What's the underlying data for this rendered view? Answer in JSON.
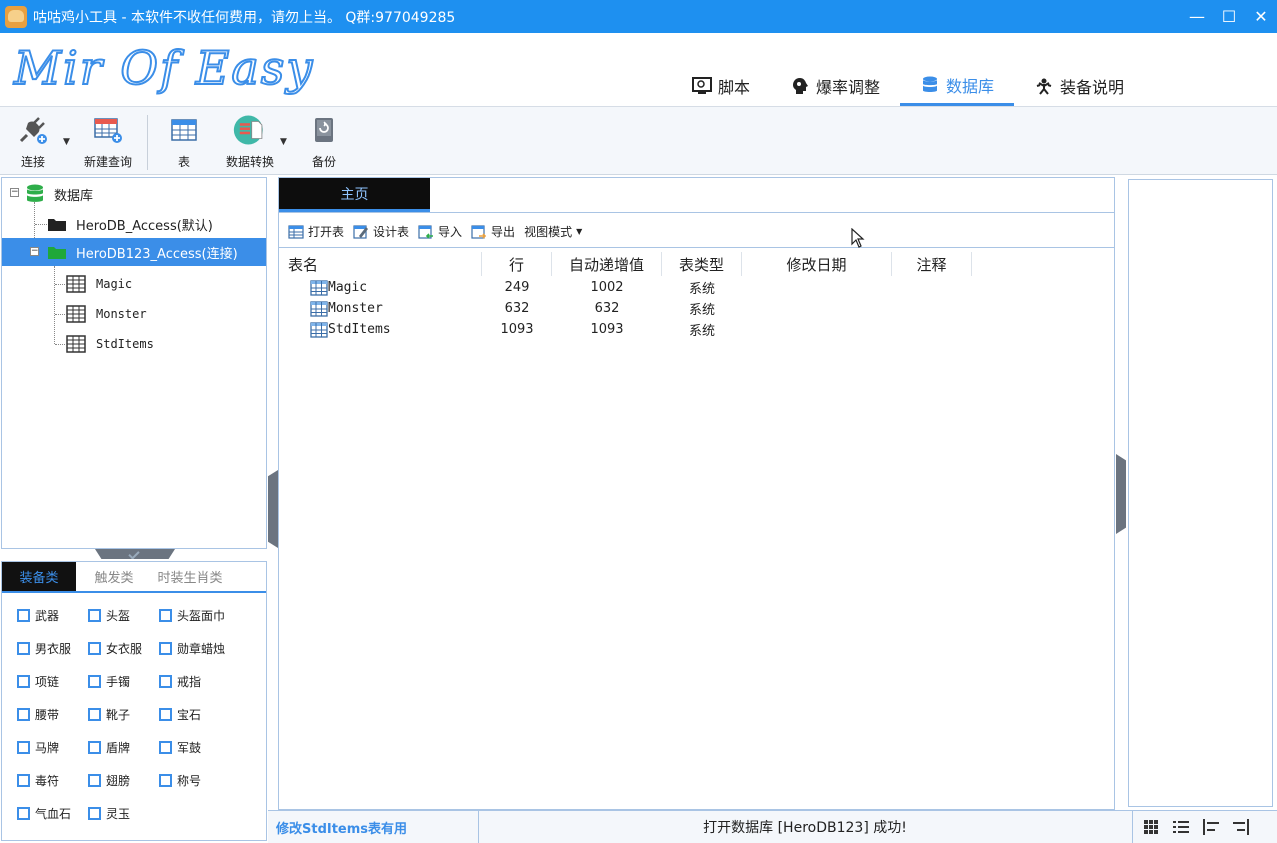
{
  "window": {
    "title": "咕咕鸡小工具 - 本软件不收任何费用，请勿上当。   Q群:977049285",
    "minimize": "—",
    "maximize": "☐",
    "close": "✕"
  },
  "header": {
    "logo": "Mir Of Easy",
    "tabs": [
      {
        "label": "脚本",
        "icon": "monitor-icon"
      },
      {
        "label": "爆率调整",
        "icon": "head-gear-icon"
      },
      {
        "label": "数据库",
        "icon": "database-icon"
      },
      {
        "label": "装备说明",
        "icon": "figure-icon"
      }
    ],
    "active_tab": "数据库"
  },
  "toolbar": {
    "connect": "连接",
    "new_query": "新建查询",
    "table": "表",
    "data_convert": "数据转换",
    "backup": "备份"
  },
  "tree": {
    "root": "数据库",
    "nodes": [
      {
        "label": "HeroDB_Access(默认)"
      },
      {
        "label": "HeroDB123_Access(连接)"
      }
    ],
    "tables": [
      "Magic",
      "Monster",
      "StdItems"
    ]
  },
  "categories": {
    "tabs": [
      "装备类",
      "触发类",
      "时装生肖类"
    ],
    "items": [
      "武器",
      "头盔",
      "头盔面巾",
      "男衣服",
      "女衣服",
      "勋章蜡烛",
      "项链",
      "手镯",
      "戒指",
      "腰带",
      "靴子",
      "宝石",
      "马牌",
      "盾牌",
      "军鼓",
      "毒符",
      "翅膀",
      "称号",
      "气血石",
      "灵玉"
    ]
  },
  "center": {
    "doc_tab": "主页",
    "subtoolbar": {
      "open_table": "打开表",
      "design_table": "设计表",
      "import": "导入",
      "export": "导出",
      "view_mode": "视图模式"
    },
    "columns": [
      "表名",
      "行",
      "自动递增值",
      "表类型",
      "修改日期",
      "注释"
    ],
    "rows": [
      {
        "name": "Magic",
        "rows": "249",
        "auto_inc": "1002",
        "type": "系统"
      },
      {
        "name": "Monster",
        "rows": "632",
        "auto_inc": "632",
        "type": "系统"
      },
      {
        "name": "StdItems",
        "rows": "1093",
        "auto_inc": "1093",
        "type": "系统"
      }
    ]
  },
  "status": {
    "left": "修改StdItems表有用",
    "message": "打开数据库 [HeroDB123] 成功!"
  },
  "colors": {
    "accent": "#3b8ee8",
    "titlebar": "#1e90f0",
    "selected_row": "#3b8ee8"
  }
}
